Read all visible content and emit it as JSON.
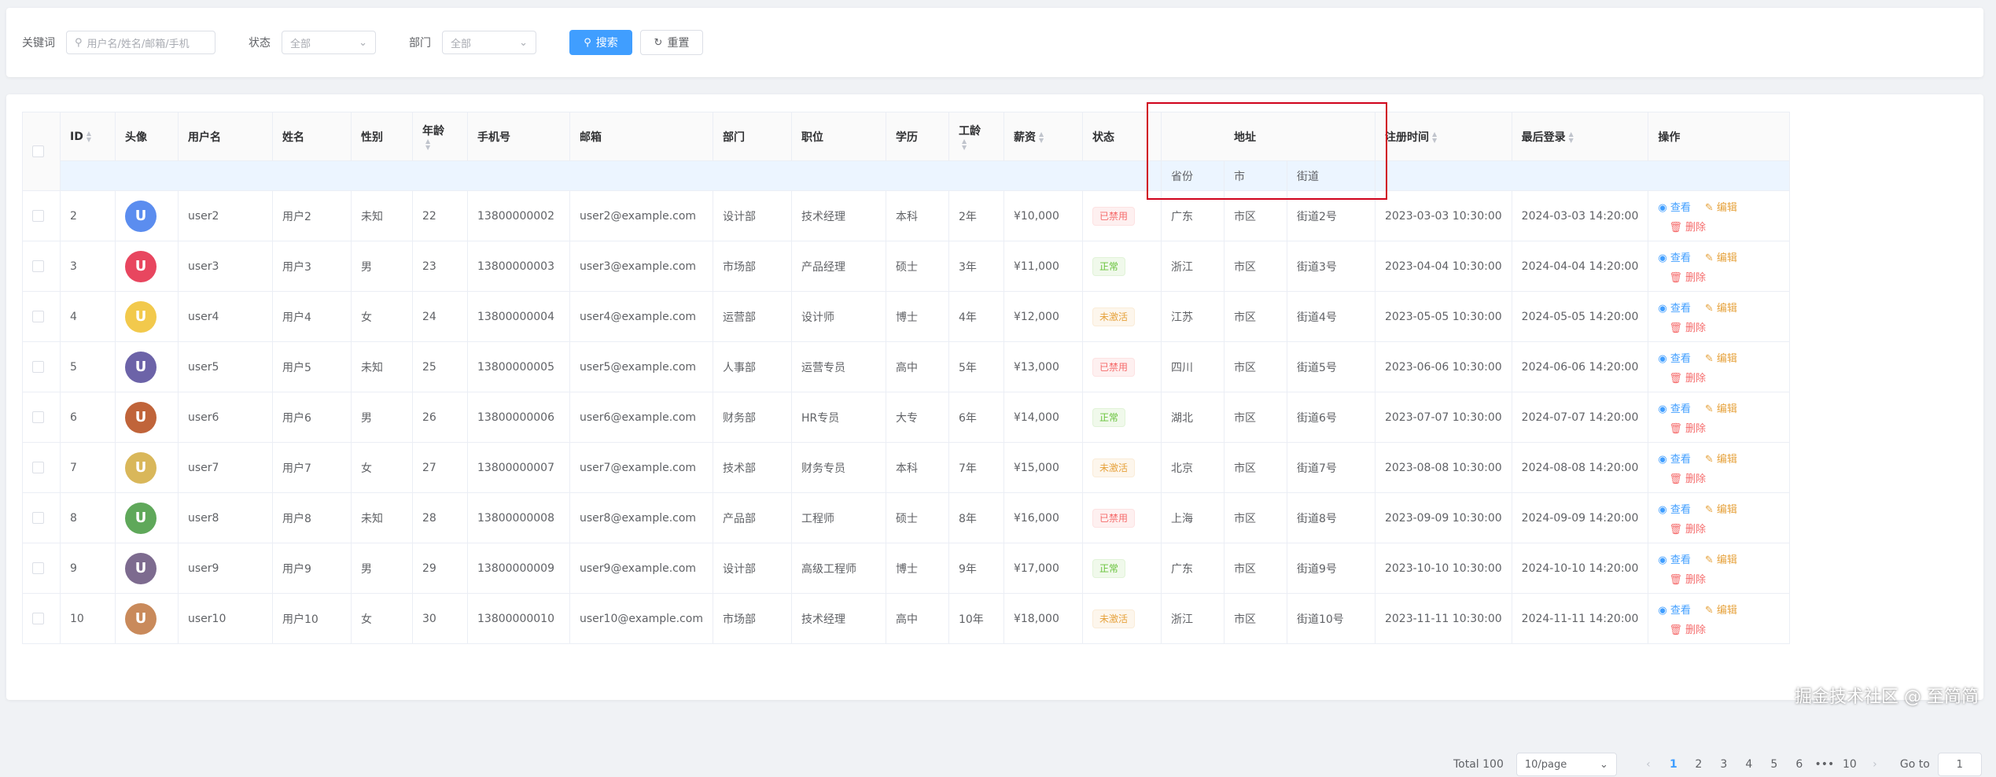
{
  "filter": {
    "keyword_label": "关键词",
    "keyword_placeholder": "用户名/姓名/邮箱/手机",
    "status_label": "状态",
    "status_value": "全部",
    "dept_label": "部门",
    "dept_value": "全部",
    "search_label": "搜索",
    "reset_label": "重置"
  },
  "table": {
    "headers": {
      "id": "ID",
      "avatar": "头像",
      "username": "用户名",
      "name": "姓名",
      "gender": "性别",
      "age": "年龄",
      "phone": "手机号",
      "email": "邮箱",
      "dept": "部门",
      "position": "职位",
      "edu": "学历",
      "work_years": "工龄",
      "salary": "薪资",
      "status": "状态",
      "address": "地址",
      "province": "省份",
      "city": "市",
      "street": "街道",
      "register_time": "注册时间",
      "last_login": "最后登录",
      "ops": "操作"
    },
    "actions": {
      "view": "查看",
      "edit": "编辑",
      "delete": "删除"
    },
    "rows": [
      {
        "id": "2",
        "initial": "U",
        "avatar_color": "#5b8def",
        "username": "user2",
        "name": "用户2",
        "gender": "未知",
        "age": "22",
        "phone": "13800000002",
        "email": "user2@example.com",
        "dept": "设计部",
        "position": "技术经理",
        "edu": "本科",
        "work_years": "2年",
        "salary": "¥10,000",
        "status": "已禁用",
        "status_type": "danger",
        "province": "广东",
        "city": "市区",
        "street": "街道2号",
        "register_time": "2023-03-03 10:30:00",
        "last_login": "2024-03-03 14:20:00"
      },
      {
        "id": "3",
        "initial": "U",
        "avatar_color": "#e8465f",
        "username": "user3",
        "name": "用户3",
        "gender": "男",
        "age": "23",
        "phone": "13800000003",
        "email": "user3@example.com",
        "dept": "市场部",
        "position": "产品经理",
        "edu": "硕士",
        "work_years": "3年",
        "salary": "¥11,000",
        "status": "正常",
        "status_type": "success",
        "province": "浙江",
        "city": "市区",
        "street": "街道3号",
        "register_time": "2023-04-04 10:30:00",
        "last_login": "2024-04-04 14:20:00"
      },
      {
        "id": "4",
        "initial": "U",
        "avatar_color": "#f2c94c",
        "username": "user4",
        "name": "用户4",
        "gender": "女",
        "age": "24",
        "phone": "13800000004",
        "email": "user4@example.com",
        "dept": "运营部",
        "position": "设计师",
        "edu": "博士",
        "work_years": "4年",
        "salary": "¥12,000",
        "status": "未激活",
        "status_type": "warning",
        "province": "江苏",
        "city": "市区",
        "street": "街道4号",
        "register_time": "2023-05-05 10:30:00",
        "last_login": "2024-05-05 14:20:00"
      },
      {
        "id": "5",
        "initial": "U",
        "avatar_color": "#6c63a8",
        "username": "user5",
        "name": "用户5",
        "gender": "未知",
        "age": "25",
        "phone": "13800000005",
        "email": "user5@example.com",
        "dept": "人事部",
        "position": "运营专员",
        "edu": "高中",
        "work_years": "5年",
        "salary": "¥13,000",
        "status": "已禁用",
        "status_type": "danger",
        "province": "四川",
        "city": "市区",
        "street": "街道5号",
        "register_time": "2023-06-06 10:30:00",
        "last_login": "2024-06-06 14:20:00"
      },
      {
        "id": "6",
        "initial": "U",
        "avatar_color": "#c0643a",
        "username": "user6",
        "name": "用户6",
        "gender": "男",
        "age": "26",
        "phone": "13800000006",
        "email": "user6@example.com",
        "dept": "财务部",
        "position": "HR专员",
        "edu": "大专",
        "work_years": "6年",
        "salary": "¥14,000",
        "status": "正常",
        "status_type": "success",
        "province": "湖北",
        "city": "市区",
        "street": "街道6号",
        "register_time": "2023-07-07 10:30:00",
        "last_login": "2024-07-07 14:20:00"
      },
      {
        "id": "7",
        "initial": "U",
        "avatar_color": "#d9b75a",
        "username": "user7",
        "name": "用户7",
        "gender": "女",
        "age": "27",
        "phone": "13800000007",
        "email": "user7@example.com",
        "dept": "技术部",
        "position": "财务专员",
        "edu": "本科",
        "work_years": "7年",
        "salary": "¥15,000",
        "status": "未激活",
        "status_type": "warning",
        "province": "北京",
        "city": "市区",
        "street": "街道7号",
        "register_time": "2023-08-08 10:30:00",
        "last_login": "2024-08-08 14:20:00"
      },
      {
        "id": "8",
        "initial": "U",
        "avatar_color": "#5fa85a",
        "username": "user8",
        "name": "用户8",
        "gender": "未知",
        "age": "28",
        "phone": "13800000008",
        "email": "user8@example.com",
        "dept": "产品部",
        "position": "工程师",
        "edu": "硕士",
        "work_years": "8年",
        "salary": "¥16,000",
        "status": "已禁用",
        "status_type": "danger",
        "province": "上海",
        "city": "市区",
        "street": "街道8号",
        "register_time": "2023-09-09 10:30:00",
        "last_login": "2024-09-09 14:20:00"
      },
      {
        "id": "9",
        "initial": "U",
        "avatar_color": "#7d6b8f",
        "username": "user9",
        "name": "用户9",
        "gender": "男",
        "age": "29",
        "phone": "13800000009",
        "email": "user9@example.com",
        "dept": "设计部",
        "position": "高级工程师",
        "edu": "博士",
        "work_years": "9年",
        "salary": "¥17,000",
        "status": "正常",
        "status_type": "success",
        "province": "广东",
        "city": "市区",
        "street": "街道9号",
        "register_time": "2023-10-10 10:30:00",
        "last_login": "2024-10-10 14:20:00"
      },
      {
        "id": "10",
        "initial": "U",
        "avatar_color": "#c98a5b",
        "username": "user10",
        "name": "用户10",
        "gender": "女",
        "age": "30",
        "phone": "13800000010",
        "email": "user10@example.com",
        "dept": "市场部",
        "position": "技术经理",
        "edu": "高中",
        "work_years": "10年",
        "salary": "¥18,000",
        "status": "未激活",
        "status_type": "warning",
        "province": "浙江",
        "city": "市区",
        "street": "街道10号",
        "register_time": "2023-11-11 10:30:00",
        "last_login": "2024-11-11 14:20:00"
      }
    ]
  },
  "status_colors": {
    "danger": {
      "text": "#f56c6c",
      "bg": "#fef0f0",
      "border": "#fde2e2"
    },
    "success": {
      "text": "#67c23a",
      "bg": "#f0f9eb",
      "border": "#e1f3d8"
    },
    "warning": {
      "text": "#e6a23c",
      "bg": "#fdf6ec",
      "border": "#faecd8"
    }
  },
  "pagination": {
    "total": "Total 100",
    "page_size": "10/page",
    "pages": [
      "1",
      "2",
      "3",
      "4",
      "5",
      "6"
    ],
    "ellipsis": "•••",
    "last_page": "10",
    "current": "1",
    "goto_label": "Go to",
    "goto_value": "1"
  },
  "watermark": "掘金技术社区 @ 至简简"
}
